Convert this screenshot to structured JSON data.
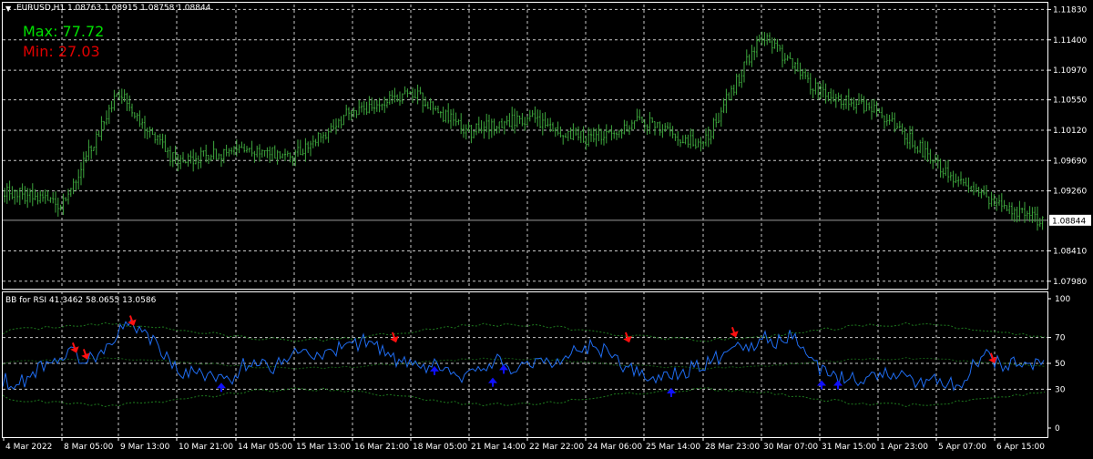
{
  "symbol_info": "EURUSD,H1  1.08763 1.08915 1.08758 1.08844",
  "stats": {
    "max_label": "Max: 77.72",
    "min_label": "Min: 27.03"
  },
  "indicator_title": "BB for RSI 41.3462 58.0655 13.0586",
  "colors": {
    "background": "#000000",
    "grid": "#c8c8c8",
    "price_bars": "#3ea83e",
    "rsi_line": "#1f6cf0",
    "bands": "#1e7a1e",
    "up_arrow": "#1010ff",
    "down_arrow": "#ff1010",
    "max_text": "#00e000",
    "min_text": "#e00000"
  },
  "price_axis": {
    "ticks": [
      "1.11830",
      "1.11400",
      "1.10970",
      "1.10550",
      "1.10120",
      "1.09690",
      "1.09260",
      "1.08410",
      "1.07980"
    ],
    "current_price": "1.08844"
  },
  "rsi_axis": {
    "ticks": [
      "100",
      "70",
      "50",
      "30",
      "0"
    ]
  },
  "time_axis": {
    "labels": [
      "4 Mar 2022",
      "8 Mar 05:00",
      "9 Mar 13:00",
      "10 Mar 21:00",
      "14 Mar 05:00",
      "15 Mar 13:00",
      "16 Mar 21:00",
      "18 Mar 05:00",
      "21 Mar 14:00",
      "22 Mar 22:00",
      "24 Mar 06:00",
      "25 Mar 14:00",
      "28 Mar 23:00",
      "30 Mar 07:00",
      "31 Mar 15:00",
      "1 Apr 23:00",
      "5 Apr 07:00",
      "6 Apr 15:00"
    ]
  },
  "chart_data": [
    {
      "type": "price-bars",
      "price_anchors": [
        {
          "label": "4 Mar 2022",
          "price": 1.0928
        },
        {
          "label": "8 Mar 05:00",
          "price": 1.0908
        },
        {
          "label": "9 Mar 13:00",
          "price": 1.1065
        },
        {
          "label": "10 Mar 21:00",
          "price": 1.0965
        },
        {
          "label": "14 Mar 05:00",
          "price": 1.0985
        },
        {
          "label": "15 Mar 13:00",
          "price": 1.0975
        },
        {
          "label": "16 Mar 21:00",
          "price": 1.104
        },
        {
          "label": "18 Mar 05:00",
          "price": 1.1065
        },
        {
          "label": "21 Mar 14:00",
          "price": 1.101
        },
        {
          "label": "22 Mar 22:00",
          "price": 1.103
        },
        {
          "label": "24 Mar 06:00",
          "price": 1.1
        },
        {
          "label": "25 Mar 14:00",
          "price": 1.1025
        },
        {
          "label": "28 Mar 23:00",
          "price": 1.099
        },
        {
          "label": "30 Mar 07:00",
          "price": 1.115
        },
        {
          "label": "31 Mar 15:00",
          "price": 1.1065
        },
        {
          "label": "1 Apr 23:00",
          "price": 1.104
        },
        {
          "label": "5 Apr 07:00",
          "price": 1.0965
        },
        {
          "label": "6 Apr 15:00",
          "price": 1.0905
        }
      ],
      "last_price": 1.08844,
      "ylim": [
        1.079,
        1.119
      ]
    },
    {
      "type": "rsi-bollinger",
      "rsi_values": [
        38,
        32,
        42,
        50,
        55,
        58,
        52,
        60,
        72,
        80,
        76,
        64,
        48,
        42,
        44,
        38,
        36,
        48,
        52,
        46,
        54,
        60,
        58,
        55,
        62,
        65,
        68,
        60,
        52,
        48,
        44,
        50,
        40,
        38,
        46,
        52,
        48,
        45,
        55,
        50,
        56,
        60,
        64,
        58,
        48,
        44,
        36,
        40,
        42,
        46,
        50,
        56,
        66,
        62,
        70,
        66,
        72,
        60,
        46,
        38,
        40,
        36,
        42,
        44,
        40,
        34,
        38,
        36,
        34,
        48,
        56,
        48,
        52,
        50,
        48
      ],
      "upper_band": 82,
      "lower_band": 18,
      "down_arrow_values": [
        58,
        53,
        79,
        66,
        66,
        70,
        50
      ],
      "up_arrow_values": [
        35,
        48,
        39,
        49,
        31,
        37,
        37
      ],
      "ylim": [
        0,
        100
      ]
    }
  ]
}
